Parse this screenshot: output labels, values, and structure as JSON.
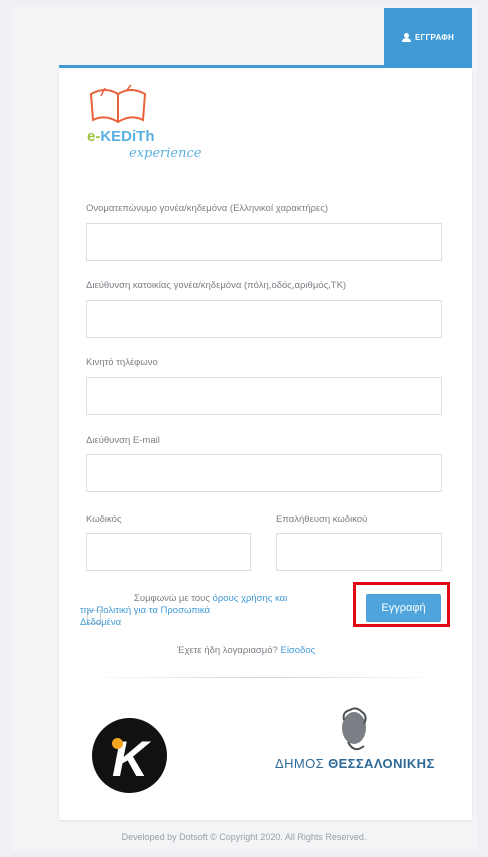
{
  "header": {
    "register_tab": "ΕΓΓΡΑΦΗ"
  },
  "logo": {
    "brand_prefix": "e-",
    "brand_name": "KEDiTh",
    "tagline": "experience"
  },
  "form": {
    "fullname_label": "Ονοματεπώνυμο γονέα/κηδεμόνα (Ελληνικοί χαρακτήρες)",
    "address_label": "Διεύθυνση κατοικίας γονέα/κηδεμόνα (πόλη,οδός,αριθμός,ΤΚ)",
    "mobile_label": "Κινητό τηλέφωνο",
    "email_label": "Διεύθυνση E-mail",
    "password_label": "Κωδικός",
    "confirm_password_label": "Επαλήθευση κωδικού",
    "agree_prefix": "Συμφωνώ με τους ",
    "terms_link": "όρους χρήσης και",
    "privacy_link_line1": "την Πολιτική για τα Προσωπικά",
    "privacy_link_line2": "Δεδομένα",
    "register_button": "Εγγραφή",
    "have_account": "Έχετε ήδη λογαριασμό? ",
    "login_link": "Είσοδος"
  },
  "partners": {
    "city_prefix": "ΔΗΜΟΣ ",
    "city_name": "ΘΕΣΣΑΛΟΝΙΚΗΣ",
    "kedith_logo": "K"
  },
  "footer": {
    "text": "Developed by Dotsoft © Copyright 2020. All Rights Reserved."
  },
  "colors": {
    "accent": "#3f9ad6",
    "highlight": "#e30613"
  }
}
